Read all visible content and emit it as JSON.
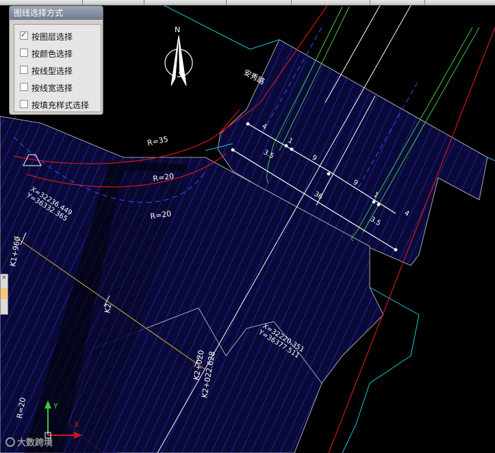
{
  "panel": {
    "title": "图线选择方式",
    "options": [
      {
        "label": "按图层选择",
        "checked": true
      },
      {
        "label": "按颜色选择",
        "checked": false
      },
      {
        "label": "按线型选择",
        "checked": false
      },
      {
        "label": "按线宽选择",
        "checked": false
      },
      {
        "label": "按填充样式选择",
        "checked": false
      }
    ]
  },
  "compass": {
    "label": "N"
  },
  "road_name": "安秀路",
  "labels": {
    "r35": "R=35",
    "r20_a": "R=20",
    "r20_b": "R=20",
    "r20_c": "R=20",
    "coord1_x": "X=32236.449",
    "coord1_y": "Y=36332.365",
    "coord2_x": "X=32220.351",
    "coord2_y": "Y=36377.511",
    "k1_station": "K1+960",
    "k2_station": "K2",
    "k2_020": "K2+020",
    "k2_022": "K2+022.628"
  },
  "dimensions": {
    "top": [
      "4",
      "1",
      "9"
    ],
    "d35_upper": "3.5",
    "total": "36",
    "right": [
      "9",
      "1",
      "4"
    ],
    "d35_lower": "3.5"
  },
  "ucs": {
    "x": "X",
    "y": "Y"
  },
  "watermark": "大数跨境",
  "colors": {
    "background": "#000000",
    "hatch": "#2f2fc8",
    "red_line": "#d01818",
    "cyan_line": "#1fc6d6",
    "green_line": "#3cc83c",
    "yellow_line": "#d8b020",
    "white_line": "#ffffff"
  }
}
